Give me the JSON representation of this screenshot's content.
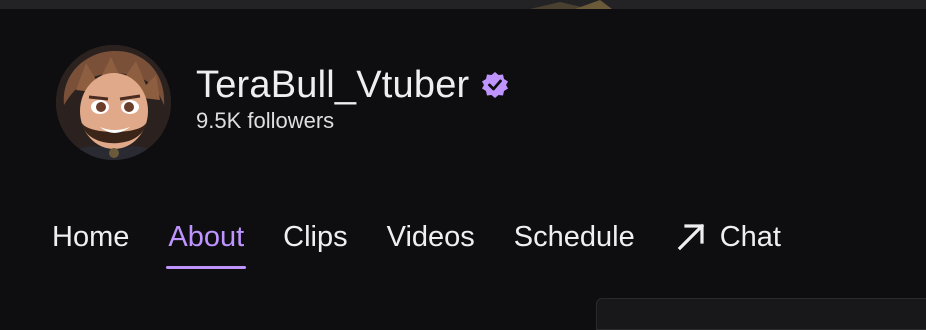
{
  "channel": {
    "name": "TeraBull_Vtuber",
    "followers": "9.5K followers",
    "verified": true,
    "accent_color": "#bf94ff"
  },
  "tabs": [
    {
      "label": "Home",
      "active": false
    },
    {
      "label": "About",
      "active": true
    },
    {
      "label": "Clips",
      "active": false
    },
    {
      "label": "Videos",
      "active": false
    },
    {
      "label": "Schedule",
      "active": false
    },
    {
      "label": "Chat",
      "active": false,
      "icon": "arrow-up-right-icon"
    }
  ]
}
